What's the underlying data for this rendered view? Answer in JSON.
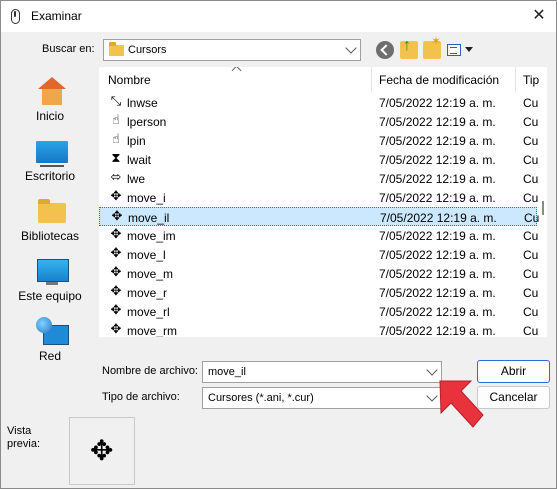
{
  "window": {
    "title": "Examinar",
    "close_glyph": "✕"
  },
  "lookin": {
    "label": "Buscar en:",
    "value": "Cursors"
  },
  "toolbar": {
    "back_icon": "back-arrow-icon",
    "up_icon": "up-folder-icon",
    "new_folder_icon": "new-folder-icon",
    "view_icon": "view-menu-icon"
  },
  "places": [
    {
      "label": "Inicio",
      "icon": "home-icon"
    },
    {
      "label": "Escritorio",
      "icon": "desktop-icon"
    },
    {
      "label": "Bibliotecas",
      "icon": "libraries-icon"
    },
    {
      "label": "Este equipo",
      "icon": "computer-icon"
    },
    {
      "label": "Red",
      "icon": "network-icon"
    }
  ],
  "columns": {
    "name": "Nombre",
    "date": "Fecha de modificación",
    "type": "Tip"
  },
  "files": [
    {
      "glyph": "⤡",
      "name": "lnwse",
      "date": "7/05/2022 12:19 a. m.",
      "type": "Cu",
      "selected": false
    },
    {
      "glyph": "☝",
      "name": "lperson",
      "date": "7/05/2022 12:19 a. m.",
      "type": "Cu",
      "selected": false
    },
    {
      "glyph": "☝",
      "name": "lpin",
      "date": "7/05/2022 12:19 a. m.",
      "type": "Cu",
      "selected": false
    },
    {
      "glyph": "⧗",
      "name": "lwait",
      "date": "7/05/2022 12:19 a. m.",
      "type": "Cu",
      "selected": false
    },
    {
      "glyph": "⬄",
      "name": "lwe",
      "date": "7/05/2022 12:19 a. m.",
      "type": "Cu",
      "selected": false
    },
    {
      "glyph": "✥",
      "name": "move_i",
      "date": "7/05/2022 12:19 a. m.",
      "type": "Cu",
      "selected": false
    },
    {
      "glyph": "✥",
      "name": "move_il",
      "date": "7/05/2022 12:19 a. m.",
      "type": "Cu",
      "selected": true
    },
    {
      "glyph": "✥",
      "name": "move_im",
      "date": "7/05/2022 12:19 a. m.",
      "type": "Cu",
      "selected": false
    },
    {
      "glyph": "✥",
      "name": "move_l",
      "date": "7/05/2022 12:19 a. m.",
      "type": "Cu",
      "selected": false
    },
    {
      "glyph": "✥",
      "name": "move_m",
      "date": "7/05/2022 12:19 a. m.",
      "type": "Cu",
      "selected": false
    },
    {
      "glyph": "✥",
      "name": "move_r",
      "date": "7/05/2022 12:19 a. m.",
      "type": "Cu",
      "selected": false
    },
    {
      "glyph": "✥",
      "name": "move_rl",
      "date": "7/05/2022 12:19 a. m.",
      "type": "Cu",
      "selected": false
    },
    {
      "glyph": "✥",
      "name": "move_rm",
      "date": "7/05/2022 12:19 a. m.",
      "type": "Cu",
      "selected": false
    }
  ],
  "filename": {
    "label": "Nombre de archivo:",
    "value": "move_il"
  },
  "filetype": {
    "label": "Tipo de archivo:",
    "value": "Cursores (*.ani, *.cur)"
  },
  "buttons": {
    "open": "Abrir",
    "cancel": "Cancelar"
  },
  "preview": {
    "label": "Vista previa:",
    "glyph": "✥"
  },
  "colors": {
    "selection": "#cce8ff",
    "accent": "#2b6fcc",
    "callout_arrow": "#e8323c"
  }
}
